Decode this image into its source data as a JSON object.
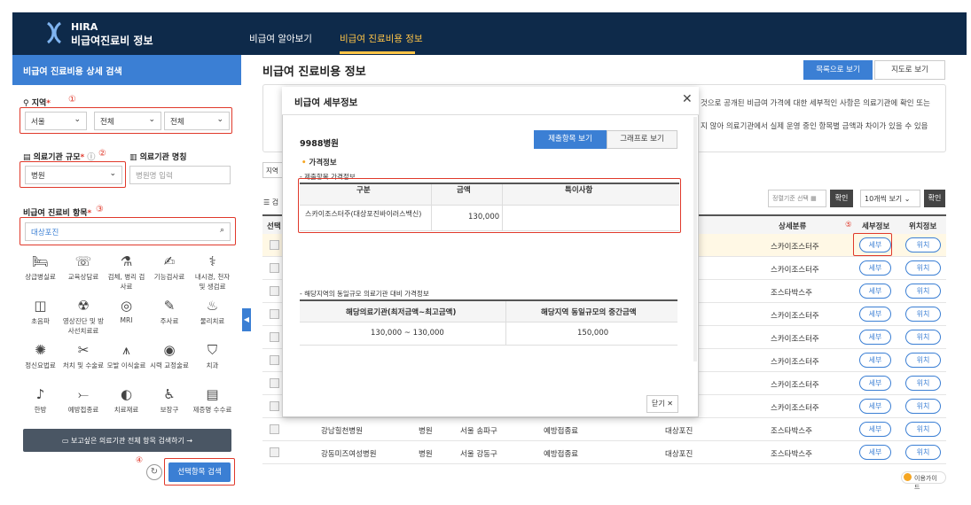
{
  "header": {
    "logo_en": "HIRA",
    "logo_ko": "비급여진료비 정보",
    "nav": [
      "비급여 알아보기",
      "비급여 진료비용 정보"
    ],
    "active_color": "#ffc447",
    "bg": "#0e2a4a"
  },
  "sidebar": {
    "title": "비급여 진료비용 상세 검색",
    "region": {
      "label": "지역",
      "marker": "①",
      "values": [
        "서울",
        "전체",
        "전체"
      ]
    },
    "hosp_size": {
      "label": "의료기관 규모",
      "marker": "②",
      "value": "병원"
    },
    "hosp_name": {
      "label": "의료기관 명칭",
      "placeholder": "병원명 입력"
    },
    "item": {
      "label": "비급여 진료비 항목",
      "marker": "③",
      "value": "대상포진"
    },
    "categories": [
      {
        "label": "상급병실료",
        "icon": "bed-icon"
      },
      {
        "label": "교육상담료",
        "icon": "consult-icon"
      },
      {
        "label": "검체, 병리 검사료",
        "icon": "lab-icon"
      },
      {
        "label": "기능검사료",
        "icon": "function-test-icon"
      },
      {
        "label": "내시경, 천자 및 생검료",
        "icon": "endoscope-icon"
      },
      {
        "label": "초음파",
        "icon": "ultrasound-icon"
      },
      {
        "label": "영상진단 및 방사선치료료",
        "icon": "radiology-icon"
      },
      {
        "label": "MRI",
        "icon": "mri-icon"
      },
      {
        "label": "주사료",
        "icon": "injection-icon"
      },
      {
        "label": "물리치료",
        "icon": "physio-icon"
      },
      {
        "label": "정신요법료",
        "icon": "psychotherapy-icon"
      },
      {
        "label": "처치 및 수술료",
        "icon": "surgery-icon"
      },
      {
        "label": "모발 이식술료",
        "icon": "hair-icon"
      },
      {
        "label": "시력 교정술료",
        "icon": "eye-icon"
      },
      {
        "label": "치과",
        "icon": "tooth-icon"
      },
      {
        "label": "한방",
        "icon": "ear-icon"
      },
      {
        "label": "예방접종료",
        "icon": "vaccine-icon"
      },
      {
        "label": "치료재료",
        "icon": "material-icon"
      },
      {
        "label": "보장구",
        "icon": "wheelchair-icon"
      },
      {
        "label": "제증명 수수료",
        "icon": "certificate-icon"
      }
    ],
    "info_bar": "보고싶은 의료기관 전체 항목 검색하기  →",
    "marker4": "④",
    "apply": "선택항목 검색"
  },
  "main": {
    "title": "비급여 진료비용 정보",
    "view_list": "목록으로 보기",
    "view_map": "지도로 보기",
    "notice": [
      "것으로 공개된 비급여 가격에 대한 세부적인 사항은 의료기관에 확인 또는",
      "지 않아 의료기관에서 실제 운영 중인 항목별 금액과 차이가 있을 수 있음"
    ],
    "region_stub": "지역",
    "total_stub": "검",
    "sort": "정렬기준 선택",
    "confirm": "확인",
    "per_page": "10개씩 보기",
    "headers": {
      "select": "선택",
      "sub": "상세분류",
      "marker5": "⑤",
      "detail": "세부정보",
      "loc": "위치정보"
    },
    "rows": [
      {
        "sub": "스카이조스터주",
        "detail": "세부",
        "loc": "위치"
      },
      {
        "sub": "스카이조스터주",
        "detail": "세부",
        "loc": "위치"
      },
      {
        "sub": "조스타박스주",
        "detail": "세부",
        "loc": "위치"
      },
      {
        "sub": "스카이조스터주",
        "detail": "세부",
        "loc": "위치"
      },
      {
        "sub": "스카이조스터주",
        "detail": "세부",
        "loc": "위치"
      },
      {
        "sub": "스카이조스터주",
        "detail": "세부",
        "loc": "위치"
      },
      {
        "sub": "스카이조스터주",
        "detail": "세부",
        "loc": "위치"
      },
      {
        "sub": "스카이조스터주",
        "detail": "세부",
        "loc": "위치"
      },
      {
        "name": "강남힐천병원",
        "type": "병원",
        "region": "서울 송파구",
        "cat": "예방접종료",
        "item": "대상포진",
        "sub": "조스타박스주",
        "detail": "세부",
        "loc": "위치"
      },
      {
        "name": "강동미즈여성병원",
        "type": "병원",
        "region": "서울 강동구",
        "cat": "예방접종료",
        "item": "대상포진",
        "sub": "조스타박스주",
        "detail": "세부",
        "loc": "위치"
      }
    ],
    "usage_guide": "이용가이드"
  },
  "modal": {
    "title": "비급여 세부정보",
    "hospital": "9988병원",
    "tab_items": "제출항목 보기",
    "tab_graph": "그래프로 보기",
    "section_price": "가격정보",
    "sub_price": "- 제출항목 가격정보",
    "price_headers": [
      "구분",
      "금액",
      "특이사항"
    ],
    "price_row": {
      "name": "스카이조스터주(대상포진바이러스백신)",
      "amount": "130,000",
      "note": ""
    },
    "sub_compare": "- 해당지역의 동일규모 의료기관 대비 가격정보",
    "compare_headers": [
      "해당의료기관(최저금액~최고금액)",
      "해당지역 동일규모의 중간금액"
    ],
    "compare_row": [
      "130,000 ~ 130,000",
      "150,000"
    ],
    "close": "닫기 ✕"
  }
}
